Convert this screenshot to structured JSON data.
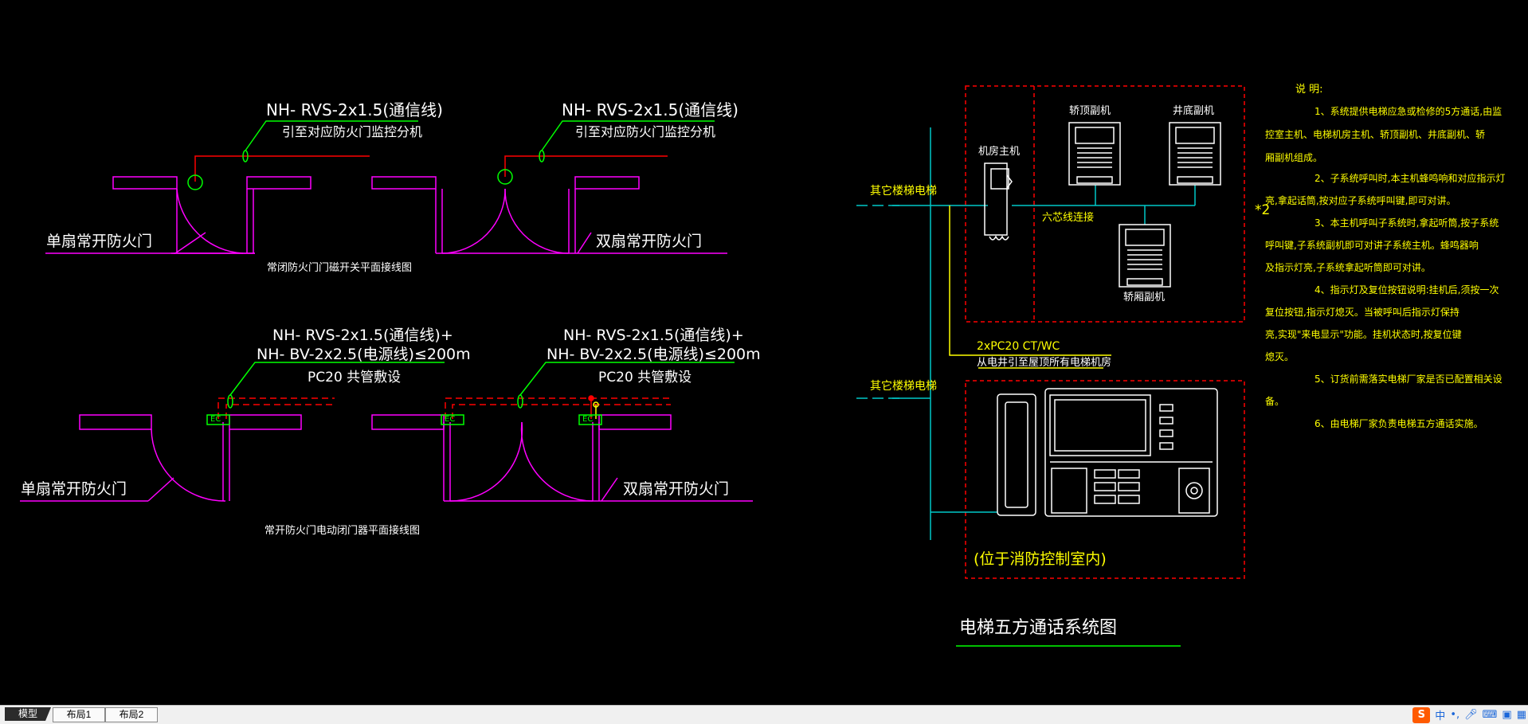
{
  "left_panel": {
    "diagram1": {
      "callout_left_line1": "NH- RVS-2x1.5(通信线)",
      "callout_left_line2": "引至对应防火门监控分机",
      "callout_right_line1": "NH- RVS-2x1.5(通信线)",
      "callout_right_line2": "引至对应防火门监控分机",
      "label_single_door": "单扇常开防火门",
      "label_double_door": "双扇常开防火门",
      "caption": "常闭防火门门磁开关平面接线图"
    },
    "diagram2": {
      "callout_left_line1": "NH- RVS-2x1.5(通信线)+",
      "callout_left_line2": "NH- BV-2x2.5(电源线)≤200m",
      "callout_left_line3": "PC20 共管敷设",
      "callout_right_line1": "NH- RVS-2x1.5(通信线)+",
      "callout_right_line2": "NH- BV-2x2.5(电源线)≤200m",
      "callout_right_line3": "PC20 共管敷设",
      "ec_tag": "EC",
      "label_single_door": "单扇常开防火门",
      "label_double_door": "双扇常开防火门",
      "caption": "常开防火门电动闭门器平面接线图"
    }
  },
  "right_panel": {
    "label_other_elevator_top": "其它楼梯电梯",
    "label_other_elevator_bottom": "其它楼梯电梯",
    "label_machine_room_host": "机房主机",
    "label_car_top_unit": "轿顶副机",
    "label_pit_unit": "井底副机",
    "label_car_unit": "轿厢副机",
    "label_six_core": "六芯线连接",
    "label_multiplier": "*2",
    "cable_line1": "2xPC20   CT/WC",
    "cable_line2": "从电井引至屋顶所有电梯机房",
    "label_location": "(位于消防控制室内)",
    "title": "电梯五方通话系统图",
    "notes_title": "说  明:",
    "notes": [
      "1、系统提供电梯应急或检修的5方通话,由监",
      "控室主机、电梯机房主机、轿顶副机、井底副机、轿",
      "厢副机组成。",
      "2、子系统呼叫时,本主机蜂鸣响和对应指示灯",
      "亮,拿起话筒,按对应子系统呼叫键,即可对讲。",
      "3、本主机呼叫子系统时,拿起听筒,按子系统",
      "呼叫键,子系统副机即可对讲子系统主机。蜂鸣器响",
      "及指示灯亮,子系统拿起听筒即可对讲。",
      "4、指示灯及复位按钮说明:挂机后,须按一次",
      "复位按钮,指示灯熄灭。当被呼叫后指示灯保持",
      "亮,实现\"来电显示\"功能。挂机状态时,按复位键",
      "熄灭。",
      "5、订货前需落实电梯厂家是否已配置相关设",
      "备。",
      "6、由电梯厂家负责电梯五方通话实施。"
    ]
  },
  "tabs": [
    {
      "label": "模型",
      "active": true
    },
    {
      "label": "布局1",
      "active": false
    },
    {
      "label": "布局2",
      "active": false
    }
  ],
  "ime": {
    "logo": "S",
    "mode": "中"
  },
  "colors": {
    "magenta": "#ff00ff",
    "green": "#00ff00",
    "red": "#ff0000",
    "cyan": "#00c8c8",
    "yellow": "#ffff00",
    "white": "#ffffff"
  }
}
